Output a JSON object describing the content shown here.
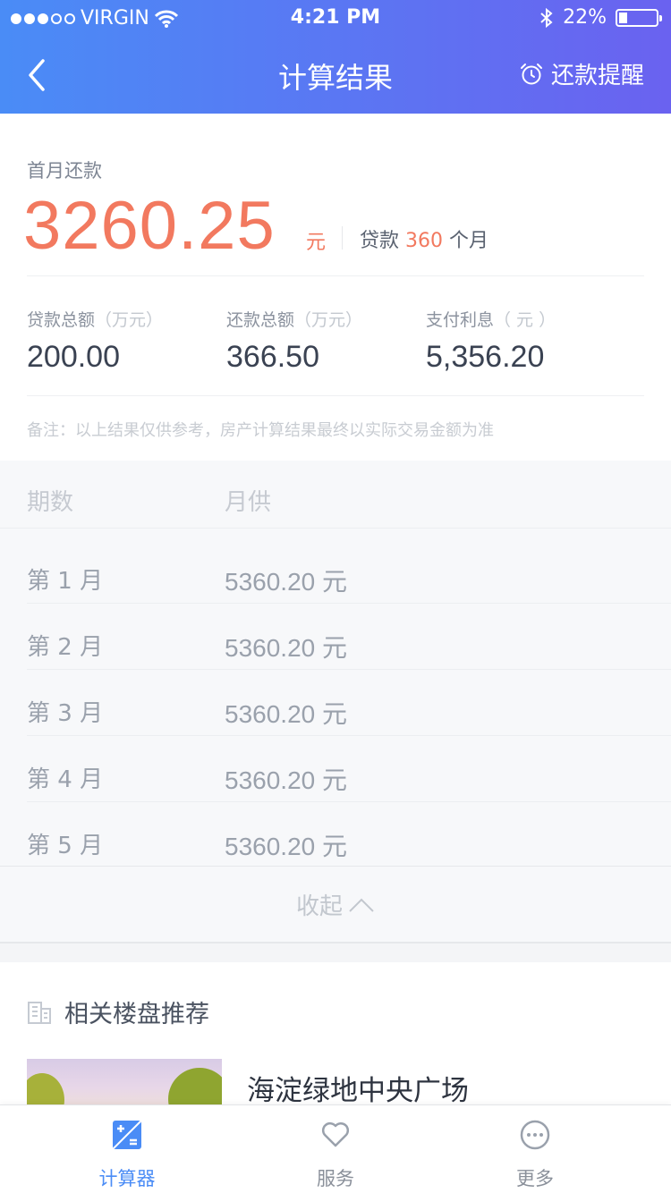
{
  "status_bar": {
    "carrier": "VIRGIN",
    "time": "4:21 PM",
    "battery": "22%",
    "battery_level": 0.22
  },
  "nav": {
    "title": "计算结果",
    "remind_label": "还款提醒"
  },
  "summary": {
    "first_month_label": "首月还款",
    "first_month_amount": "3260.25",
    "amount_unit": "元",
    "term_prefix": "贷款",
    "term_months": "360",
    "term_suffix": "个月",
    "stats": [
      {
        "label": "贷款总额",
        "unit": "（万元）",
        "value": "200.00"
      },
      {
        "label": "还款总额",
        "unit": "（万元）",
        "value": "366.50"
      },
      {
        "label": "支付利息",
        "unit": "（ 元 ）",
        "value": "5,356.20"
      }
    ],
    "note": "备注：以上结果仅供参考，房产计算结果最终以实际交易金额为准"
  },
  "schedule": {
    "headers": [
      "期数",
      "月供"
    ],
    "rows": [
      {
        "period": "第 1 月",
        "payment": "5360.20 元"
      },
      {
        "period": "第 2 月",
        "payment": "5360.20 元"
      },
      {
        "period": "第 3 月",
        "payment": "5360.20 元"
      },
      {
        "period": "第 4 月",
        "payment": "5360.20 元"
      },
      {
        "period": "第 5 月",
        "payment": "5360.20 元"
      }
    ],
    "collapse_label": "收起"
  },
  "recommend": {
    "title": "相关楼盘推荐",
    "items": [
      {
        "name": "海淀绿地中央广场"
      }
    ]
  },
  "tabbar": {
    "items": [
      {
        "label": "计算器",
        "icon": "calculator-icon",
        "active": true
      },
      {
        "label": "服务",
        "icon": "heart-icon",
        "active": false
      },
      {
        "label": "更多",
        "icon": "more-icon",
        "active": false
      }
    ]
  },
  "colors": {
    "accent": "#4a8cf6",
    "header_gradient_end": "#6a62f0",
    "highlight": "#f2795f"
  }
}
